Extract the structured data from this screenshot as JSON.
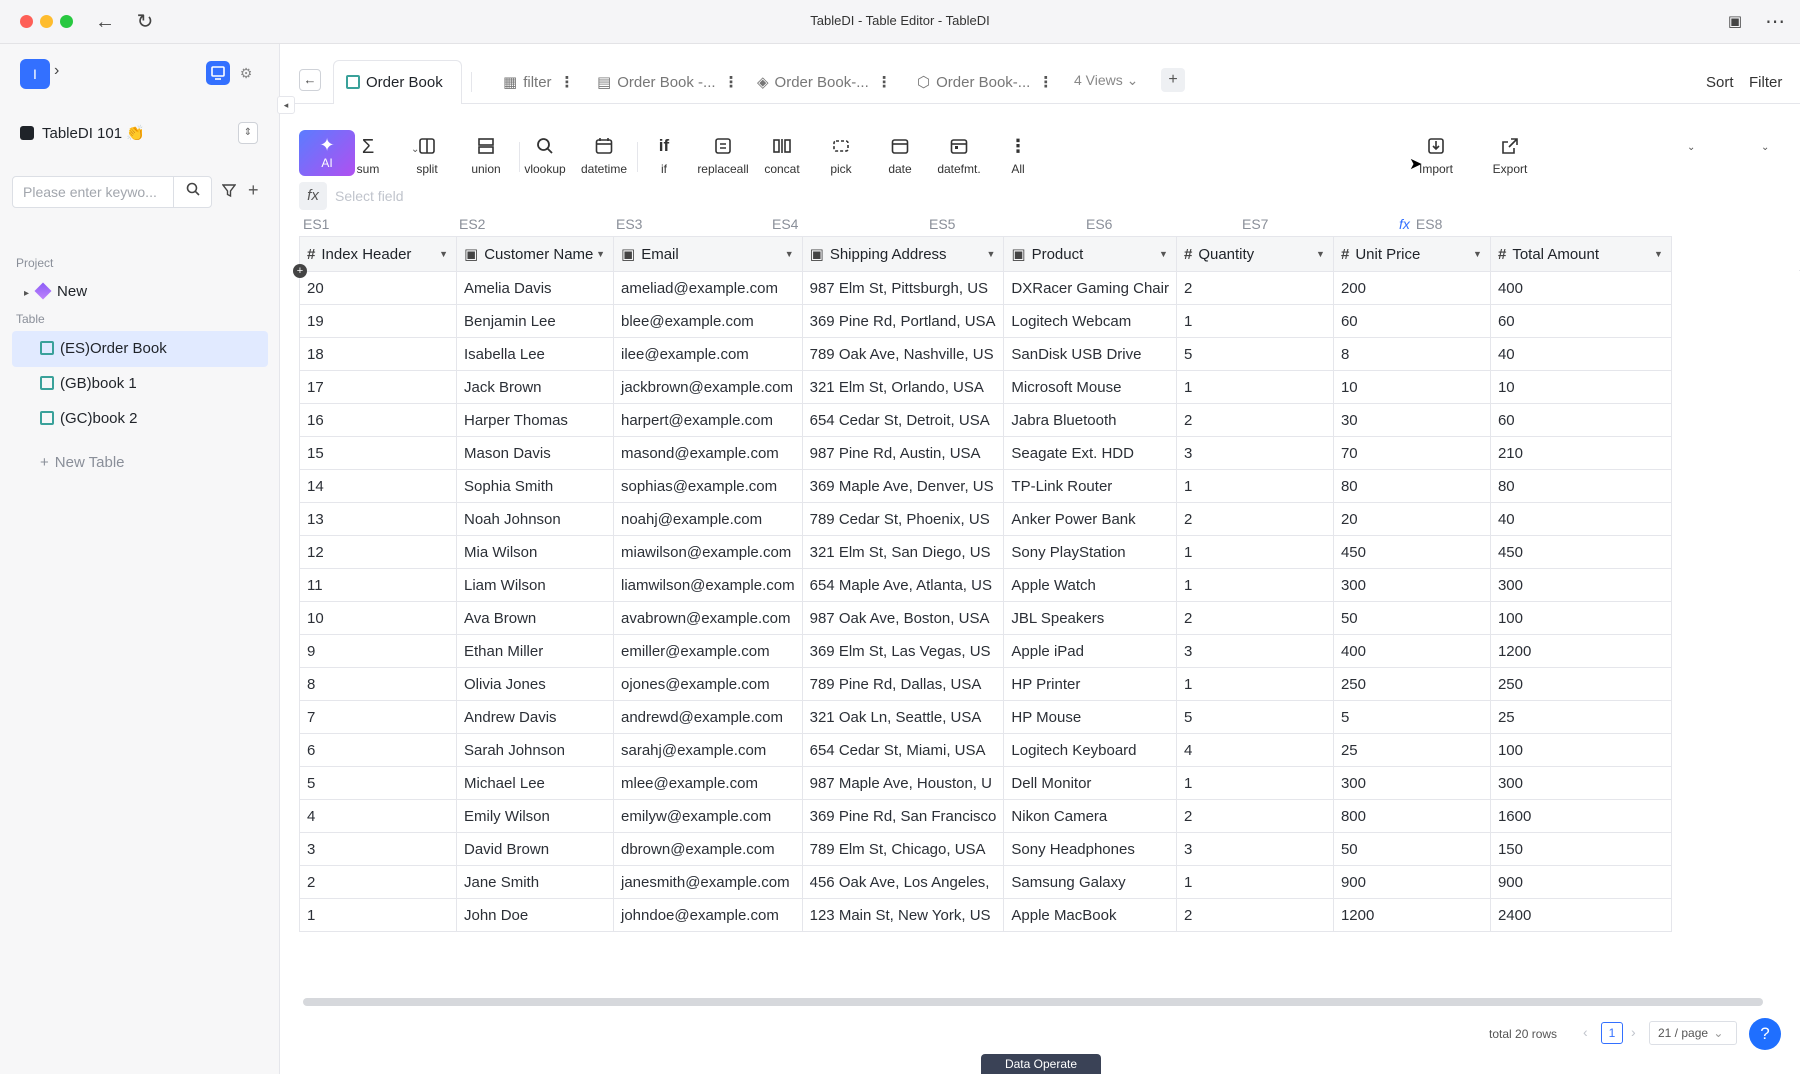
{
  "window": {
    "title": "TableDI - Table Editor - TableDI"
  },
  "sidebar": {
    "logo": "I",
    "project_name": "TableDI 101 👏",
    "search_placeholder": "Please enter keywo...",
    "section_project": "Project",
    "section_table": "Table",
    "project_item": "New",
    "tables": [
      "(ES)Order Book",
      "(GB)book 1",
      "(GC)book 2"
    ],
    "new_table": "New Table"
  },
  "tabs": {
    "active": "Order Book",
    "others": [
      "filter",
      "Order Book -...",
      "Order Book-...",
      "Order Book-..."
    ],
    "views": "4 Views",
    "add": "+",
    "sort": "Sort",
    "filter": "Filter"
  },
  "toolbar": {
    "ai": "AI",
    "tools": [
      "sum",
      "split",
      "union",
      "vlookup",
      "datetime",
      "if",
      "replaceall",
      "concat",
      "pick",
      "date",
      "datefmt.",
      "All"
    ],
    "import": "Import",
    "export": "Export",
    "fx_placeholder": "Select field"
  },
  "grid": {
    "codes": [
      "ES1",
      "ES2",
      "ES3",
      "ES4",
      "ES5",
      "ES6",
      "ES7",
      "ES8"
    ],
    "headers": [
      "Index Header",
      "Customer Name",
      "Email",
      "Shipping Address",
      "Product",
      "Quantity",
      "Unit Price",
      "Total Amount"
    ],
    "rows": [
      [
        "20",
        "Amelia Davis",
        "ameliad@example.com",
        "987 Elm St, Pittsburgh, US",
        "DXRacer Gaming Chair",
        "2",
        "200",
        "400"
      ],
      [
        "19",
        "Benjamin Lee",
        "blee@example.com",
        "369 Pine Rd, Portland, USA",
        "Logitech Webcam",
        "1",
        "60",
        "60"
      ],
      [
        "18",
        "Isabella Lee",
        "ilee@example.com",
        "789 Oak Ave, Nashville, US",
        "SanDisk USB Drive",
        "5",
        "8",
        "40"
      ],
      [
        "17",
        "Jack Brown",
        "jackbrown@example.com",
        "321 Elm St, Orlando, USA",
        "Microsoft Mouse",
        "1",
        "10",
        "10"
      ],
      [
        "16",
        "Harper Thomas",
        "harpert@example.com",
        "654 Cedar St, Detroit, USA",
        "Jabra Bluetooth",
        "2",
        "30",
        "60"
      ],
      [
        "15",
        "Mason Davis",
        "masond@example.com",
        "987 Pine Rd, Austin, USA",
        "Seagate Ext. HDD",
        "3",
        "70",
        "210"
      ],
      [
        "14",
        "Sophia Smith",
        "sophias@example.com",
        "369 Maple Ave, Denver, US",
        "TP-Link Router",
        "1",
        "80",
        "80"
      ],
      [
        "13",
        "Noah Johnson",
        "noahj@example.com",
        "789 Cedar St, Phoenix, US",
        "Anker Power Bank",
        "2",
        "20",
        "40"
      ],
      [
        "12",
        "Mia Wilson",
        "miawilson@example.com",
        "321 Elm St, San Diego, US",
        "Sony PlayStation",
        "1",
        "450",
        "450"
      ],
      [
        "11",
        "Liam Wilson",
        "liamwilson@example.com",
        "654 Maple Ave, Atlanta, US",
        "Apple Watch",
        "1",
        "300",
        "300"
      ],
      [
        "10",
        "Ava Brown",
        "avabrown@example.com",
        "987 Oak Ave, Boston, USA",
        "JBL Speakers",
        "2",
        "50",
        "100"
      ],
      [
        "9",
        "Ethan Miller",
        "emiller@example.com",
        "369 Elm St, Las Vegas, US",
        "Apple iPad",
        "3",
        "400",
        "1200"
      ],
      [
        "8",
        "Olivia Jones",
        "ojones@example.com",
        "789 Pine Rd, Dallas, USA",
        "HP Printer",
        "1",
        "250",
        "250"
      ],
      [
        "7",
        "Andrew Davis",
        "andrewd@example.com",
        "321 Oak Ln, Seattle, USA",
        "HP Mouse",
        "5",
        "5",
        "25"
      ],
      [
        "6",
        "Sarah Johnson",
        "sarahj@example.com",
        "654 Cedar St, Miami, USA",
        "Logitech Keyboard",
        "4",
        "25",
        "100"
      ],
      [
        "5",
        "Michael Lee",
        "mlee@example.com",
        "987 Maple Ave, Houston, U",
        "Dell Monitor",
        "1",
        "300",
        "300"
      ],
      [
        "4",
        "Emily Wilson",
        "emilyw@example.com",
        "369 Pine Rd, San Francisco",
        "Nikon Camera",
        "2",
        "800",
        "1600"
      ],
      [
        "3",
        "David Brown",
        "dbrown@example.com",
        "789 Elm St, Chicago, USA",
        "Sony Headphones",
        "3",
        "50",
        "150"
      ],
      [
        "2",
        "Jane Smith",
        "janesmith@example.com",
        "456 Oak Ave, Los Angeles,",
        "Samsung Galaxy",
        "1",
        "900",
        "900"
      ],
      [
        "1",
        "John Doe",
        "johndoe@example.com",
        "123 Main St, New York, US",
        "Apple MacBook",
        "2",
        "1200",
        "2400"
      ]
    ]
  },
  "footer": {
    "total": "total 20 rows",
    "page": "1",
    "page_size": "21 / page",
    "help": "?",
    "data_operate": "Data Operate"
  },
  "colors": {
    "accent": "#3370ff",
    "active_row": "#e1eaff"
  }
}
